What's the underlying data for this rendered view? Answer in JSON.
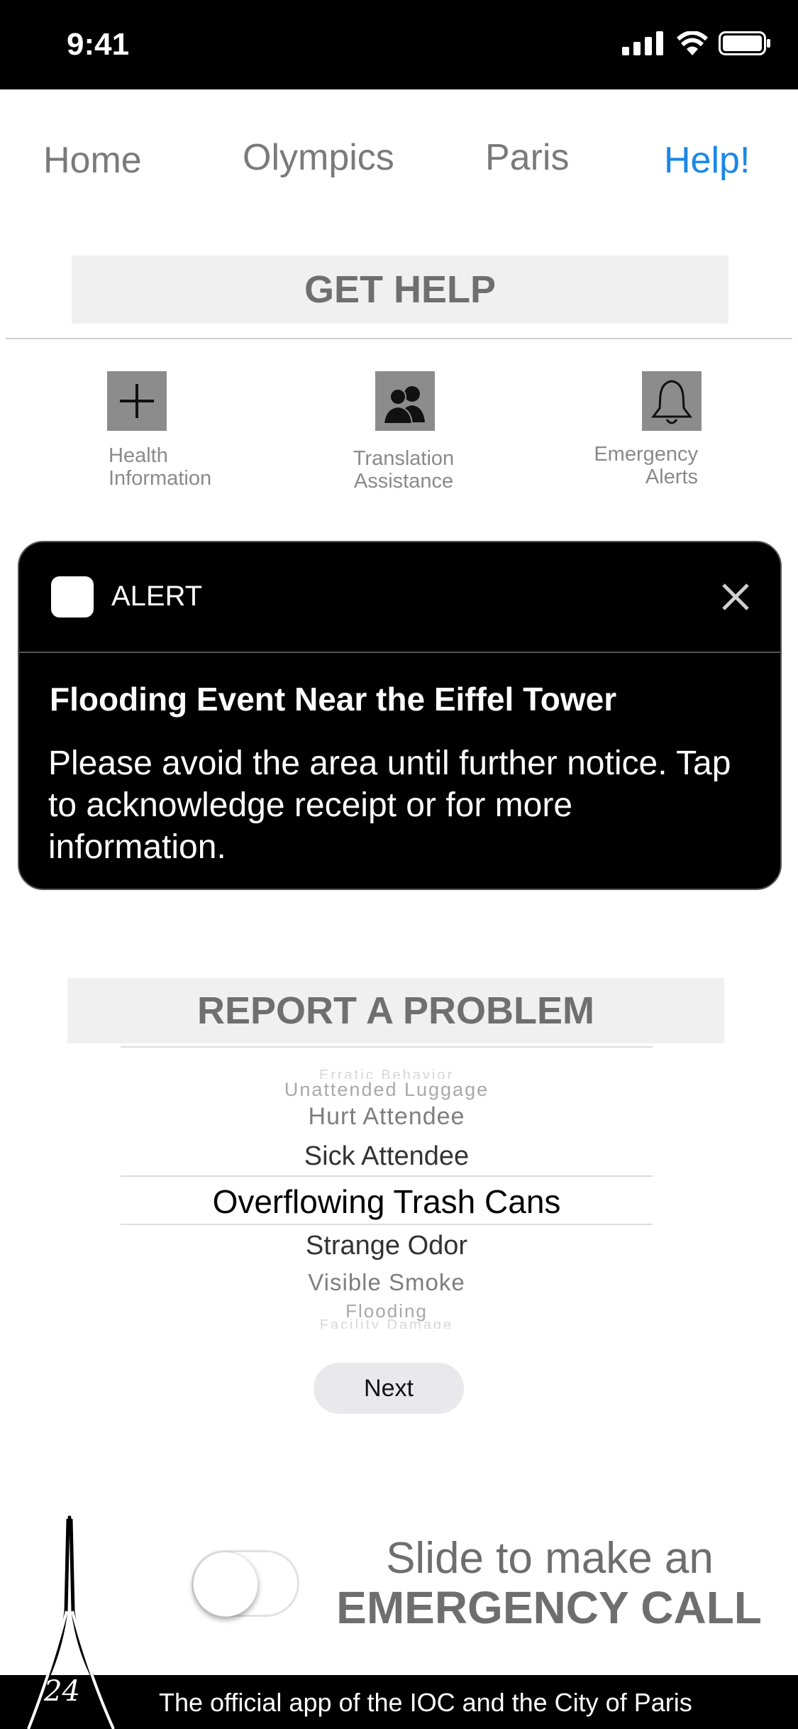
{
  "status_bar": {
    "time": "9:41",
    "icons": [
      "signal-icon",
      "wifi-icon",
      "battery-icon"
    ]
  },
  "nav": {
    "items": [
      {
        "label": "Home"
      },
      {
        "label": "Olympics"
      },
      {
        "label": "Paris"
      },
      {
        "label": "Help!",
        "active": true
      }
    ]
  },
  "get_help": {
    "title": "GET HELP",
    "tiles": [
      {
        "icon": "plus-icon",
        "label_line1": "Health",
        "label_line2": "Information"
      },
      {
        "icon": "people-icon",
        "label_line1": "Translation",
        "label_line2": "Assistance"
      },
      {
        "icon": "bell-icon",
        "label_line1": "Emergency",
        "label_line2": "Alerts"
      }
    ]
  },
  "alert": {
    "app_label": "ALERT",
    "title": "Flooding Event Near the Eiffel Tower",
    "body": "Please avoid the area until further notice. Tap to acknowledge receipt or for more information."
  },
  "report": {
    "title": "REPORT A PROBLEM",
    "options": [
      "Erratic Behavior",
      "Unattended Luggage",
      "Hurt Attendee",
      "Sick Attendee",
      "Overflowing Trash Cans",
      "Strange Odor",
      "Visible Smoke",
      "Flooding",
      "Facility Damage"
    ],
    "selected": "Overflowing Trash Cans",
    "next_label": "Next"
  },
  "emergency": {
    "line1": "Slide to make an",
    "line2": "EMERGENCY CALL"
  },
  "footer": {
    "logo_text": "24",
    "text": "The official app of the IOC and the City of Paris"
  },
  "colors": {
    "accent": "#1a88e6",
    "nav_inactive": "#7a7a7a",
    "section_bg": "#f0f0f0"
  }
}
